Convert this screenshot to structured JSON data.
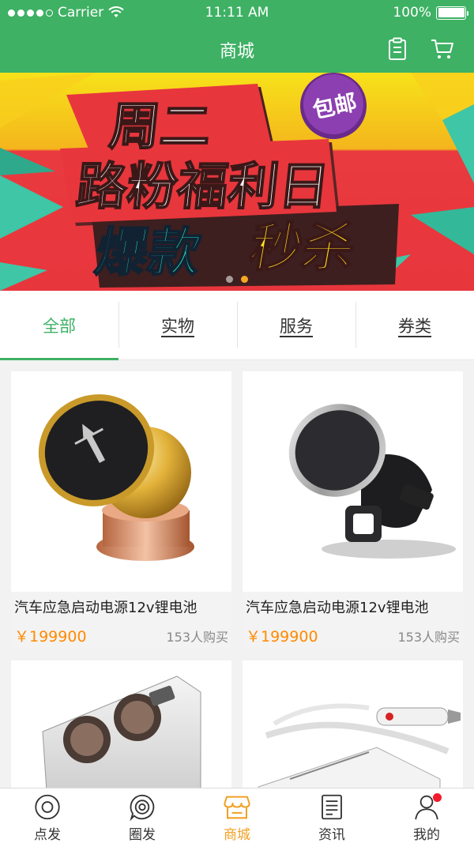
{
  "status_bar": {
    "carrier": "Carrier",
    "time": "11:11 AM",
    "battery": "100%"
  },
  "header": {
    "title": "商城",
    "icons": [
      "clipboard-icon",
      "cart-icon"
    ]
  },
  "banner": {
    "badge": "包邮",
    "line1": "周二",
    "line2": "路粉福利日",
    "line3a": "爆款",
    "line3b": "秒杀",
    "page_count": 2,
    "active_page": 2
  },
  "tabs": [
    {
      "label": "全部",
      "active": true
    },
    {
      "label": "实物",
      "active": false
    },
    {
      "label": "服务",
      "active": false
    },
    {
      "label": "券类",
      "active": false
    }
  ],
  "products": [
    {
      "name": "汽车应急启动电源12v锂电池",
      "price": "￥199900",
      "sold": "153人购买",
      "image": "magnetic-ball-phone-holder"
    },
    {
      "name": "汽车应急启动电源12v锂电池",
      "price": "￥199900",
      "sold": "153人购买",
      "image": "air-vent-magnetic-holder"
    },
    {
      "name": "",
      "price": "",
      "sold": "",
      "image": "dual-socket-car-charger"
    },
    {
      "name": "",
      "price": "",
      "sold": "",
      "image": "car-splitter-charger"
    }
  ],
  "bottom_nav": [
    {
      "label": "点发",
      "icon": "target-icon",
      "active": false
    },
    {
      "label": "圈发",
      "icon": "broadcast-icon",
      "active": false
    },
    {
      "label": "商城",
      "icon": "store-icon",
      "active": true
    },
    {
      "label": "资讯",
      "icon": "news-icon",
      "active": false
    },
    {
      "label": "我的",
      "icon": "user-icon",
      "active": false,
      "badge": true
    }
  ],
  "colors": {
    "primary": "#3eb164",
    "accent": "#f2a024",
    "price": "#ff8a00"
  }
}
